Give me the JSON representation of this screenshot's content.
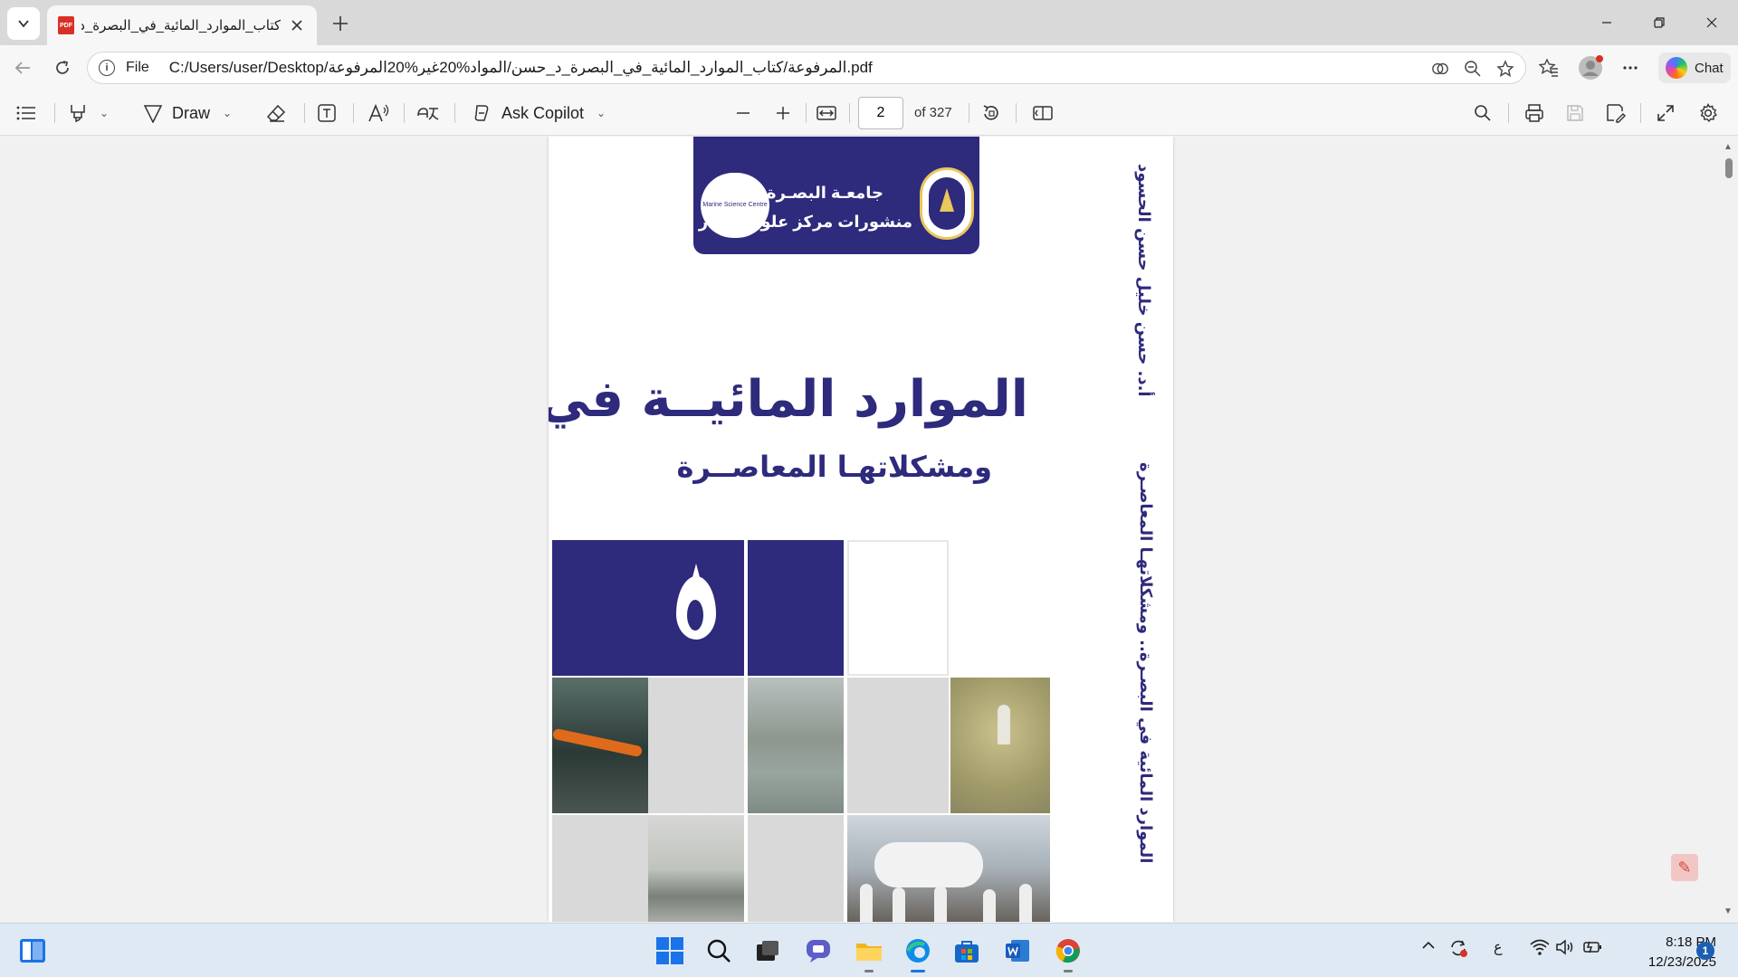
{
  "browser": {
    "tab": {
      "title": "كتاب_الموارد_المائية_في_البصرة_د_حسن",
      "favicon_label": "PDF"
    },
    "address": {
      "scheme_label": "File",
      "url": "C:/Users/user/Desktop/المرفوعة/كتاب_الموارد_المائية_في_البصرة_د_حسن/المواد%20غير%20المرفوعة.pdf"
    },
    "chat_label": "Chat"
  },
  "pdf_toolbar": {
    "draw_label": "Draw",
    "copilot_label": "Ask Copilot",
    "page_current": "2",
    "page_total": "of 327"
  },
  "document": {
    "publisher_university": "جامعـة البصـرة",
    "publisher_center": "منشورات مركز علوم البحار",
    "marine_logo_text": "Marine Science Centre",
    "title": "الموارد المائيــة في البصــرة",
    "subtitle": "ومشكلاتهـا المعاصــرة",
    "spine_author": "أ.د. حسن خليل حسن الحسود",
    "spine_title": "الموارد المائية في البصـرة.. ومشكلاتهـا المعاصـرة"
  },
  "taskbar": {
    "language": "ع",
    "time": "8:18 PM",
    "date": "12/23/2025",
    "notification_count": "1"
  },
  "colors": {
    "cover_navy": "#2e2a7c",
    "seal_gold": "#e9c75a",
    "accent": "#1a73e8"
  },
  "icons": {
    "tab_list": "chevron-down-icon",
    "back": "back-arrow-icon",
    "refresh": "refresh-icon",
    "info": "info-icon",
    "read_aloud": "read-aloud-icon",
    "zoom_out": "zoom-out-icon",
    "favorite": "star-icon",
    "collections": "collections-icon",
    "profile": "profile-icon",
    "more": "more-icon",
    "contents": "contents-icon",
    "highlight": "highlight-icon",
    "draw": "draw-icon",
    "erase": "eraser-icon",
    "text": "text-box-icon",
    "read": "read-aloud-icon",
    "translate": "translate-icon",
    "copilot": "copilot-icon",
    "minus": "minus-icon",
    "plus": "plus-icon",
    "fit_width": "fit-width-icon",
    "rotate": "rotate-icon",
    "page_view": "page-view-icon",
    "search": "search-icon",
    "print": "print-icon",
    "save": "save-icon",
    "save_as": "save-as-icon",
    "fullscreen": "expand-icon",
    "settings": "gear-icon"
  }
}
